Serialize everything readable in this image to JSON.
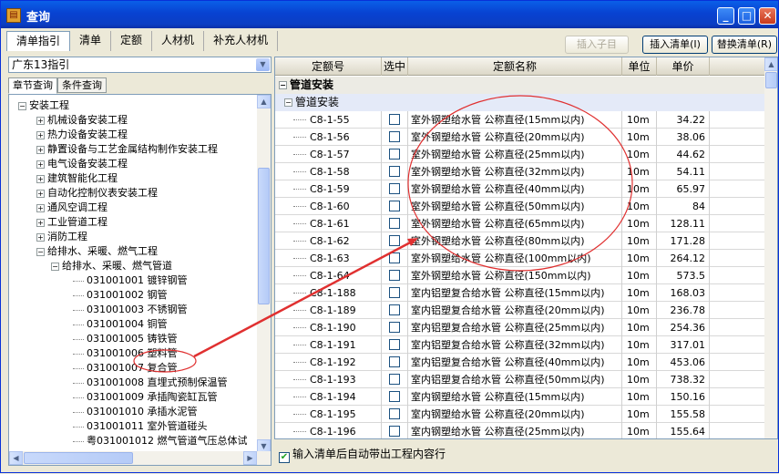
{
  "window": {
    "title": "查询",
    "app_icon": "book-icon"
  },
  "tabs": [
    "清单指引",
    "清单",
    "定额",
    "人材机",
    "补充人材机"
  ],
  "buttons": {
    "insert_child": "插入子目",
    "insert_list": "插入清单(I)",
    "replace_list": "替换清单(R)"
  },
  "left": {
    "combo_value": "广东13指引",
    "subtabs": [
      "章节查询",
      "条件查询"
    ],
    "tree": [
      {
        "label": "安装工程",
        "level": 0,
        "state": "-"
      },
      {
        "label": "机械设备安装工程",
        "level": 1,
        "state": "+"
      },
      {
        "label": "热力设备安装工程",
        "level": 1,
        "state": "+"
      },
      {
        "label": "静置设备与工艺金属结构制作安装工程",
        "level": 1,
        "state": "+"
      },
      {
        "label": "电气设备安装工程",
        "level": 1,
        "state": "+"
      },
      {
        "label": "建筑智能化工程",
        "level": 1,
        "state": "+"
      },
      {
        "label": "自动化控制仪表安装工程",
        "level": 1,
        "state": "+"
      },
      {
        "label": "通风空调工程",
        "level": 1,
        "state": "+"
      },
      {
        "label": "工业管道工程",
        "level": 1,
        "state": "+"
      },
      {
        "label": "消防工程",
        "level": 1,
        "state": "+"
      },
      {
        "label": "给排水、采暖、燃气工程",
        "level": 1,
        "state": "-"
      },
      {
        "label": "给排水、采暖、燃气管道",
        "level": 2,
        "state": "-"
      },
      {
        "label": "031001001   镀锌钢管",
        "level": 3,
        "state": ""
      },
      {
        "label": "031001002   钢管",
        "level": 3,
        "state": ""
      },
      {
        "label": "031001003   不锈钢管",
        "level": 3,
        "state": ""
      },
      {
        "label": "031001004   铜管",
        "level": 3,
        "state": ""
      },
      {
        "label": "031001005   铸铁管",
        "level": 3,
        "state": ""
      },
      {
        "label": "031001006   塑料管",
        "level": 3,
        "state": ""
      },
      {
        "label": "031001007   复合管",
        "level": 3,
        "state": ""
      },
      {
        "label": "031001008   直埋式预制保温管",
        "level": 3,
        "state": ""
      },
      {
        "label": "031001009   承插陶瓷缸瓦管",
        "level": 3,
        "state": ""
      },
      {
        "label": "031001010   承插水泥管",
        "level": 3,
        "state": ""
      },
      {
        "label": "031001011   室外管道碰头",
        "level": 3,
        "state": ""
      },
      {
        "label": "粤031001012   燃气管道气压总体试",
        "level": 3,
        "state": ""
      }
    ]
  },
  "grid": {
    "headers": [
      "定额号",
      "选中",
      "定额名称",
      "单位",
      "单价"
    ],
    "group1": "管道安装",
    "group2": "管道安装",
    "rows": [
      {
        "code": "C8-1-55",
        "name": "室外钢塑给水管 公称直径(15mm以内)",
        "unit": "10m",
        "price": "34.22"
      },
      {
        "code": "C8-1-56",
        "name": "室外钢塑给水管 公称直径(20mm以内)",
        "unit": "10m",
        "price": "38.06"
      },
      {
        "code": "C8-1-57",
        "name": "室外钢塑给水管 公称直径(25mm以内)",
        "unit": "10m",
        "price": "44.62"
      },
      {
        "code": "C8-1-58",
        "name": "室外钢塑给水管 公称直径(32mm以内)",
        "unit": "10m",
        "price": "54.11"
      },
      {
        "code": "C8-1-59",
        "name": "室外钢塑给水管 公称直径(40mm以内)",
        "unit": "10m",
        "price": "65.97"
      },
      {
        "code": "C8-1-60",
        "name": "室外钢塑给水管 公称直径(50mm以内)",
        "unit": "10m",
        "price": "84"
      },
      {
        "code": "C8-1-61",
        "name": "室外钢塑给水管 公称直径(65mm以内)",
        "unit": "10m",
        "price": "128.11"
      },
      {
        "code": "C8-1-62",
        "name": "室外钢塑给水管 公称直径(80mm以内)",
        "unit": "10m",
        "price": "171.28"
      },
      {
        "code": "C8-1-63",
        "name": "室外钢塑给水管 公称直径(100mm以内)",
        "unit": "10m",
        "price": "264.12"
      },
      {
        "code": "C8-1-64",
        "name": "室外钢塑给水管 公称直径(150mm以内)",
        "unit": "10m",
        "price": "573.5"
      },
      {
        "code": "C8-1-188",
        "name": "室内铝塑复合给水管 公称直径(15mm以内)",
        "unit": "10m",
        "price": "168.03"
      },
      {
        "code": "C8-1-189",
        "name": "室内铝塑复合给水管 公称直径(20mm以内)",
        "unit": "10m",
        "price": "236.78"
      },
      {
        "code": "C8-1-190",
        "name": "室内铝塑复合给水管 公称直径(25mm以内)",
        "unit": "10m",
        "price": "254.36"
      },
      {
        "code": "C8-1-191",
        "name": "室内铝塑复合给水管 公称直径(32mm以内)",
        "unit": "10m",
        "price": "317.01"
      },
      {
        "code": "C8-1-192",
        "name": "室内铝塑复合给水管 公称直径(40mm以内)",
        "unit": "10m",
        "price": "453.06"
      },
      {
        "code": "C8-1-193",
        "name": "室内铝塑复合给水管 公称直径(50mm以内)",
        "unit": "10m",
        "price": "738.32"
      },
      {
        "code": "C8-1-194",
        "name": "室内钢塑给水管 公称直径(15mm以内)",
        "unit": "10m",
        "price": "150.16"
      },
      {
        "code": "C8-1-195",
        "name": "室内钢塑给水管 公称直径(20mm以内)",
        "unit": "10m",
        "price": "155.58"
      },
      {
        "code": "C8-1-196",
        "name": "室内钢塑给水管 公称直径(25mm以内)",
        "unit": "10m",
        "price": "155.64"
      }
    ]
  },
  "bottom_checkbox": {
    "label": "输入清单后自动带出工程内容行",
    "checked": true
  },
  "colors": {
    "annotation": "#e03030",
    "titlebar": "#0842d1"
  }
}
